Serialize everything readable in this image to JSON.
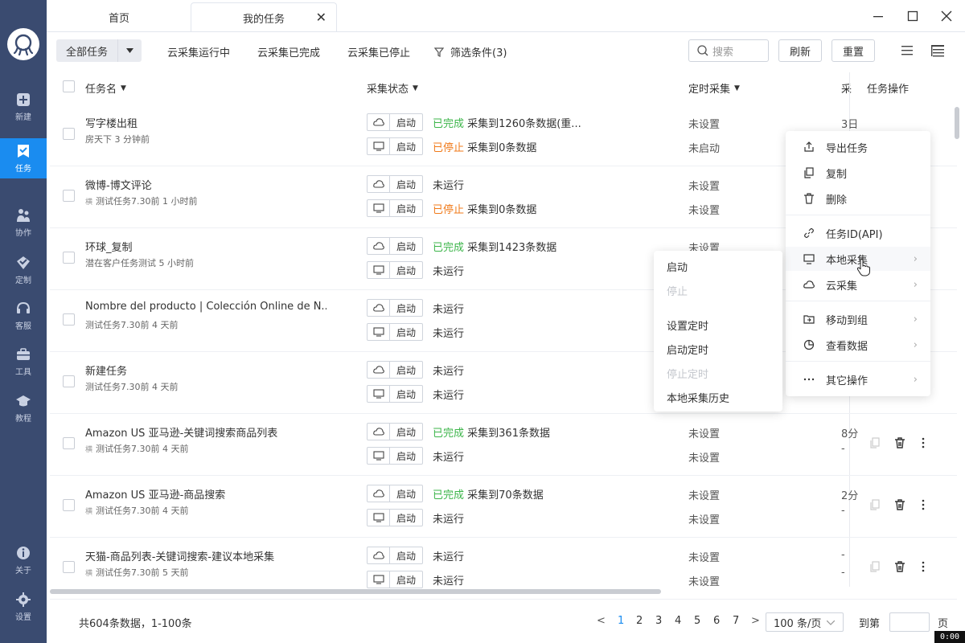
{
  "sidebar": {
    "items": [
      {
        "label": "新建",
        "icon": "plus-square-icon"
      },
      {
        "label": "任务",
        "icon": "task-icon",
        "active": true
      },
      {
        "label": "协作",
        "icon": "team-icon"
      },
      {
        "label": "定制",
        "icon": "diamond-icon"
      },
      {
        "label": "客服",
        "icon": "headset-icon"
      },
      {
        "label": "工具",
        "icon": "toolbox-icon"
      },
      {
        "label": "教程",
        "icon": "graduation-cap-icon"
      },
      {
        "label": "关于",
        "icon": "info-icon"
      },
      {
        "label": "设置",
        "icon": "gear-icon"
      }
    ]
  },
  "tabs": [
    {
      "label": "首页"
    },
    {
      "label": "我的任务",
      "active": true
    }
  ],
  "toolbar": {
    "filter_label": "全部任务",
    "quick_filters": [
      "云采集运行中",
      "云采集已完成",
      "云采集已停止"
    ],
    "conditions_label": "筛选条件(3)",
    "search_placeholder": "搜索",
    "refresh_label": "刷新",
    "reset_label": "重置"
  },
  "columns": {
    "name": "任务名",
    "status": "采集状态",
    "schedule": "定时采集",
    "col_e": "采",
    "actions": "任务操作"
  },
  "button_label": "启动",
  "rows": [
    {
      "name": "写字楼出租",
      "meta": "房天下  3 分钟前",
      "mark": "",
      "cloud": {
        "state": "已完成",
        "text": "采集到1260条数据(重...",
        "kind": "done"
      },
      "local": {
        "state": "已停止",
        "text": "采集到0条数据",
        "kind": "stop"
      },
      "sched1": "未设置",
      "sched2": "未启动",
      "e1": "3日",
      "e2": ""
    },
    {
      "name": "微博-博文评论",
      "meta": "测试任务7.30前  1 小时前",
      "mark": "横",
      "cloud": {
        "state": "",
        "text": "未运行",
        "kind": "none"
      },
      "local": {
        "state": "已停止",
        "text": "采集到0条数据",
        "kind": "stop"
      },
      "sched1": "未设置",
      "sched2": "未设置",
      "e1": "",
      "e2": ""
    },
    {
      "name": "环球_复制",
      "meta": "潜在客户任务测试  5 小时前",
      "mark": "",
      "cloud": {
        "state": "已完成",
        "text": "采集到1423条数据",
        "kind": "done"
      },
      "local": {
        "state": "",
        "text": "未运行",
        "kind": "none"
      },
      "sched1": "未设置",
      "sched2": "",
      "e1": "",
      "e2": ""
    },
    {
      "name": "Nombre del producto | Colección Online de N...",
      "meta": "测试任务7.30前  4 天前",
      "mark": "",
      "cloud": {
        "state": "",
        "text": "未运行",
        "kind": "none"
      },
      "local": {
        "state": "",
        "text": "未运行",
        "kind": "none"
      },
      "sched1": "",
      "sched2": "",
      "e1": "",
      "e2": ""
    },
    {
      "name": "新建任务",
      "meta": "测试任务7.30前  4 天前",
      "mark": "",
      "cloud": {
        "state": "",
        "text": "未运行",
        "kind": "none"
      },
      "local": {
        "state": "",
        "text": "未运行",
        "kind": "none"
      },
      "sched1": "",
      "sched2": "",
      "e1": "",
      "e2": ""
    },
    {
      "name": "Amazon US 亚马逊-关键词搜索商品列表",
      "meta": "测试任务7.30前  4 天前",
      "mark": "横",
      "cloud": {
        "state": "已完成",
        "text": "采集到361条数据",
        "kind": "done"
      },
      "local": {
        "state": "",
        "text": "未运行",
        "kind": "none"
      },
      "sched1": "未设置",
      "sched2": "未设置",
      "e1": "8分",
      "e2": "-"
    },
    {
      "name": "Amazon US 亚马逊-商品搜索",
      "meta": "测试任务7.30前  4 天前",
      "mark": "横",
      "cloud": {
        "state": "已完成",
        "text": "采集到70条数据",
        "kind": "done"
      },
      "local": {
        "state": "",
        "text": "未运行",
        "kind": "none"
      },
      "sched1": "未设置",
      "sched2": "未设置",
      "e1": "2分",
      "e2": "-"
    },
    {
      "name": "天猫-商品列表-关键词搜索-建议本地采集",
      "meta": "测试任务7.30前  5 天前",
      "mark": "横",
      "cloud": {
        "state": "",
        "text": "未运行",
        "kind": "none"
      },
      "local": {
        "state": "",
        "text": "未运行",
        "kind": "none"
      },
      "sched1": "未设置",
      "sched2": "未设置",
      "e1": "-",
      "e2": "-"
    }
  ],
  "context_menu": {
    "items": [
      "导出任务",
      "复制",
      "删除",
      "任务ID(API)",
      "本地采集",
      "云采集",
      "移动到组",
      "查看数据",
      "其它操作"
    ]
  },
  "submenu": {
    "items": [
      "启动",
      "停止",
      "设置定时",
      "启动定时",
      "停止定时",
      "本地采集历史"
    ]
  },
  "footer": {
    "total": "共604条数据，1-100条",
    "pages": [
      "1",
      "2",
      "3",
      "4",
      "5",
      "6",
      "7"
    ],
    "page_size": "100 条/页",
    "goto_label": "到第",
    "page_unit": "页",
    "prev": "<",
    "next": ">"
  },
  "badge": "0:00",
  "colors": {
    "sidebar": "#3a4b70",
    "accent": "#1a8cf0",
    "done": "#3cb54a",
    "stopped": "#f07a1a"
  }
}
